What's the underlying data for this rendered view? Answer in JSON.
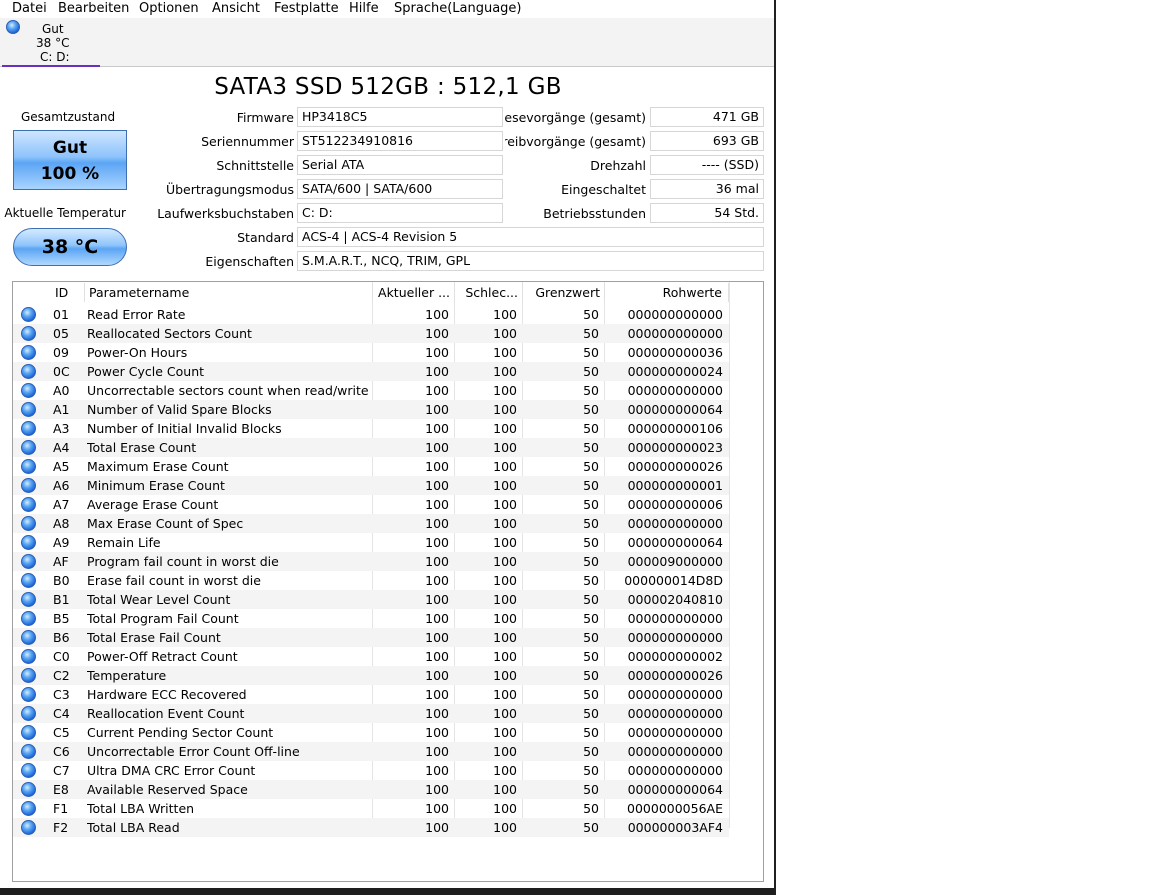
{
  "menu": [
    "Datei",
    "Bearbeiten",
    "Optionen",
    "Ansicht",
    "Festplatte",
    "Hilfe",
    "Sprache(Language)"
  ],
  "disk_tab": {
    "status": "Gut",
    "temperature": "38 °C",
    "drives": "C: D:"
  },
  "title": "SATA3 SSD 512GB : 512,1 GB",
  "health": {
    "label": "Gesamtzustand",
    "status": "Gut",
    "percent": "100 %"
  },
  "temperature": {
    "label": "Aktuelle Temperatur",
    "value": "38 °C"
  },
  "info": {
    "firmware": {
      "label": "Firmware",
      "value": "HP3418C5"
    },
    "serial": {
      "label": "Seriennummer",
      "value": "ST512234910816"
    },
    "interface": {
      "label": "Schnittstelle",
      "value": "Serial ATA"
    },
    "transfer": {
      "label": "Übertragungsmodus",
      "value": "SATA/600 | SATA/600"
    },
    "drive_letters": {
      "label": "Laufwerksbuchstaben",
      "value": "C: D:"
    },
    "standard": {
      "label": "Standard",
      "value": "ACS-4 | ACS-4 Revision 5"
    },
    "features": {
      "label": "Eigenschaften",
      "value": "S.M.A.R.T., NCQ, TRIM, GPL"
    },
    "host_reads": {
      "label": "Host-Lesevorgänge (gesamt)",
      "value": "471 GB"
    },
    "host_writes": {
      "label": "Host-Schreibvorgänge (gesamt)",
      "value": "693 GB"
    },
    "rotation": {
      "label": "Drehzahl",
      "value": "---- (SSD)"
    },
    "power_count": {
      "label": "Eingeschaltet",
      "value": "36 mal"
    },
    "power_hours": {
      "label": "Betriebsstunden",
      "value": "54 Std."
    }
  },
  "table": {
    "headers": {
      "id": "ID",
      "name": "Parametername",
      "current": "Aktueller ...",
      "worst": "Schlec...",
      "threshold": "Grenzwert",
      "raw": "Rohwerte"
    },
    "rows": [
      {
        "id": "01",
        "name": "Read Error Rate",
        "current": "100",
        "worst": "100",
        "threshold": "50",
        "raw": "000000000000"
      },
      {
        "id": "05",
        "name": "Reallocated Sectors Count",
        "current": "100",
        "worst": "100",
        "threshold": "50",
        "raw": "000000000000"
      },
      {
        "id": "09",
        "name": "Power-On Hours",
        "current": "100",
        "worst": "100",
        "threshold": "50",
        "raw": "000000000036"
      },
      {
        "id": "0C",
        "name": "Power Cycle Count",
        "current": "100",
        "worst": "100",
        "threshold": "50",
        "raw": "000000000024"
      },
      {
        "id": "A0",
        "name": "Uncorrectable sectors count when read/write",
        "current": "100",
        "worst": "100",
        "threshold": "50",
        "raw": "000000000000"
      },
      {
        "id": "A1",
        "name": "Number of Valid Spare Blocks",
        "current": "100",
        "worst": "100",
        "threshold": "50",
        "raw": "000000000064"
      },
      {
        "id": "A3",
        "name": "Number of Initial Invalid Blocks",
        "current": "100",
        "worst": "100",
        "threshold": "50",
        "raw": "000000000106"
      },
      {
        "id": "A4",
        "name": "Total Erase Count",
        "current": "100",
        "worst": "100",
        "threshold": "50",
        "raw": "000000000023"
      },
      {
        "id": "A5",
        "name": "Maximum Erase Count",
        "current": "100",
        "worst": "100",
        "threshold": "50",
        "raw": "000000000026"
      },
      {
        "id": "A6",
        "name": "Minimum Erase Count",
        "current": "100",
        "worst": "100",
        "threshold": "50",
        "raw": "000000000001"
      },
      {
        "id": "A7",
        "name": "Average Erase Count",
        "current": "100",
        "worst": "100",
        "threshold": "50",
        "raw": "000000000006"
      },
      {
        "id": "A8",
        "name": "Max Erase Count of Spec",
        "current": "100",
        "worst": "100",
        "threshold": "50",
        "raw": "000000000000"
      },
      {
        "id": "A9",
        "name": "Remain Life",
        "current": "100",
        "worst": "100",
        "threshold": "50",
        "raw": "000000000064"
      },
      {
        "id": "AF",
        "name": "Program fail count in worst die",
        "current": "100",
        "worst": "100",
        "threshold": "50",
        "raw": "000009000000"
      },
      {
        "id": "B0",
        "name": "Erase fail count in worst die",
        "current": "100",
        "worst": "100",
        "threshold": "50",
        "raw": "000000014D8D"
      },
      {
        "id": "B1",
        "name": "Total Wear Level Count",
        "current": "100",
        "worst": "100",
        "threshold": "50",
        "raw": "000002040810"
      },
      {
        "id": "B5",
        "name": "Total Program Fail Count",
        "current": "100",
        "worst": "100",
        "threshold": "50",
        "raw": "000000000000"
      },
      {
        "id": "B6",
        "name": "Total Erase Fail Count",
        "current": "100",
        "worst": "100",
        "threshold": "50",
        "raw": "000000000000"
      },
      {
        "id": "C0",
        "name": "Power-Off Retract Count",
        "current": "100",
        "worst": "100",
        "threshold": "50",
        "raw": "000000000002"
      },
      {
        "id": "C2",
        "name": "Temperature",
        "current": "100",
        "worst": "100",
        "threshold": "50",
        "raw": "000000000026"
      },
      {
        "id": "C3",
        "name": "Hardware ECC Recovered",
        "current": "100",
        "worst": "100",
        "threshold": "50",
        "raw": "000000000000"
      },
      {
        "id": "C4",
        "name": "Reallocation Event Count",
        "current": "100",
        "worst": "100",
        "threshold": "50",
        "raw": "000000000000"
      },
      {
        "id": "C5",
        "name": "Current Pending Sector Count",
        "current": "100",
        "worst": "100",
        "threshold": "50",
        "raw": "000000000000"
      },
      {
        "id": "C6",
        "name": "Uncorrectable Error Count Off-line",
        "current": "100",
        "worst": "100",
        "threshold": "50",
        "raw": "000000000000"
      },
      {
        "id": "C7",
        "name": "Ultra DMA CRC Error Count",
        "current": "100",
        "worst": "100",
        "threshold": "50",
        "raw": "000000000000"
      },
      {
        "id": "E8",
        "name": "Available Reserved Space",
        "current": "100",
        "worst": "100",
        "threshold": "50",
        "raw": "000000000064"
      },
      {
        "id": "F1",
        "name": "Total LBA Written",
        "current": "100",
        "worst": "100",
        "threshold": "50",
        "raw": "0000000056AE"
      },
      {
        "id": "F2",
        "name": "Total LBA Read",
        "current": "100",
        "worst": "100",
        "threshold": "50",
        "raw": "000000003AF4"
      }
    ]
  }
}
